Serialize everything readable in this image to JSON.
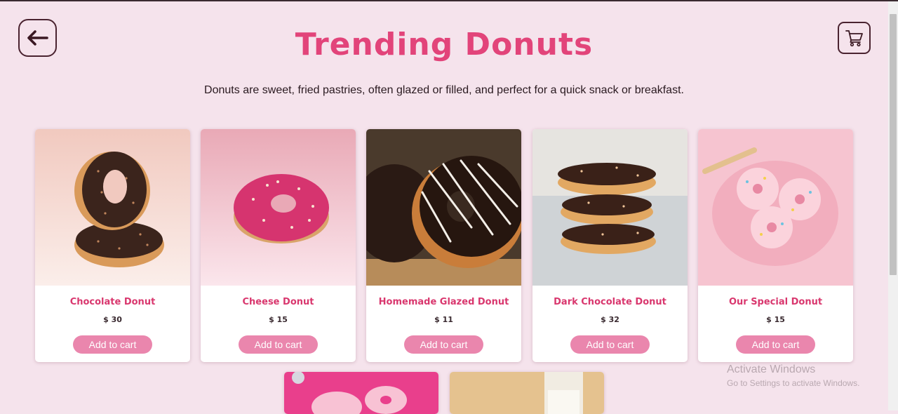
{
  "header": {
    "title": "Trending Donuts",
    "subtitle": "Donuts are sweet, fried pastries, often glazed or filled, and perfect for a quick snack or breakfast.",
    "back_icon": "arrow-left-icon",
    "cart_icon": "shopping-cart-icon"
  },
  "products": [
    {
      "name": "Chocolate Donut",
      "price": "$ 30",
      "button": "Add to cart"
    },
    {
      "name": "Cheese Donut",
      "price": "$ 15",
      "button": "Add to cart"
    },
    {
      "name": "Homemade Glazed Donut",
      "price": "$ 11",
      "button": "Add to cart"
    },
    {
      "name": "Dark Chocolate Donut",
      "price": "$ 32",
      "button": "Add to cart"
    },
    {
      "name": "Our Special Donut",
      "price": "$ 15",
      "button": "Add to cart"
    }
  ],
  "watermark": {
    "line1": "Activate Windows",
    "line2": "Go to Settings to activate Windows."
  },
  "colors": {
    "background": "#f5e3ec",
    "accent": "#e2447a",
    "button": "#ea86ad"
  }
}
